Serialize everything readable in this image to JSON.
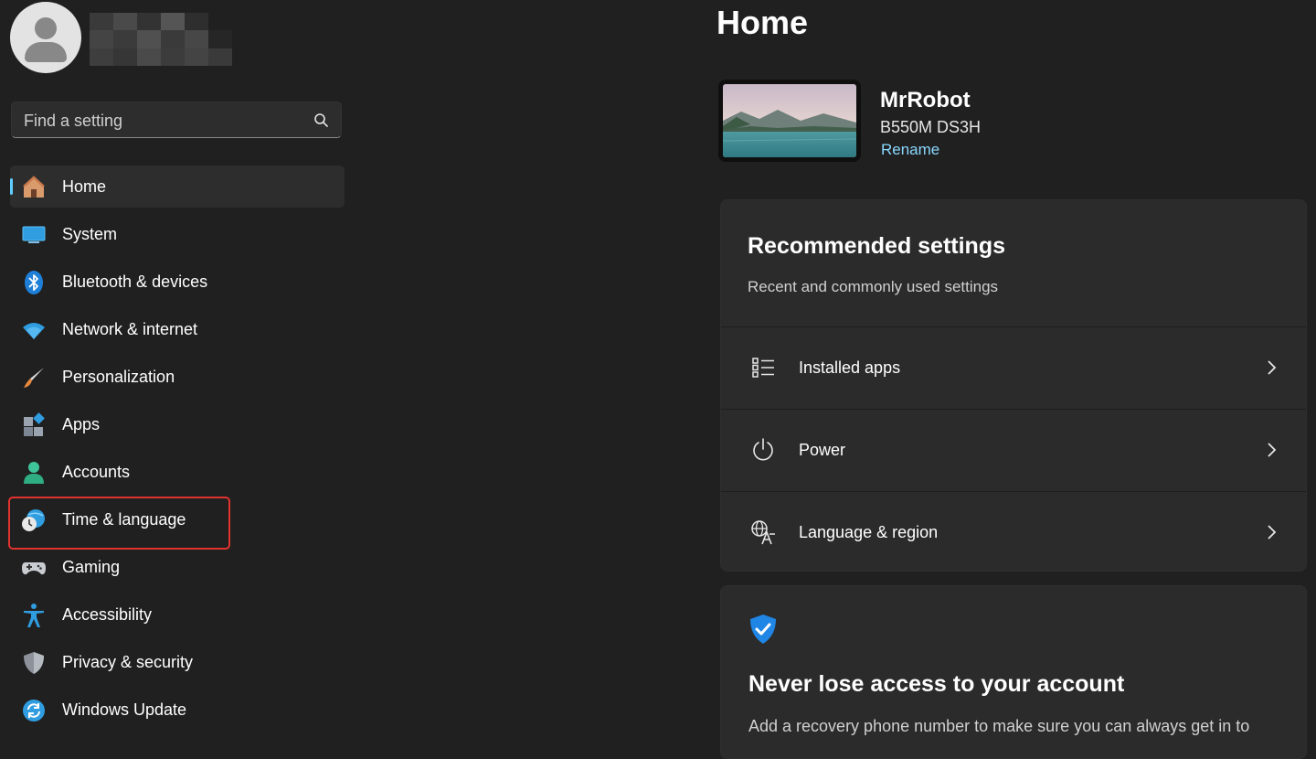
{
  "profile": {
    "avatar_icon": "user-avatar-icon"
  },
  "search": {
    "placeholder": "Find a setting",
    "icon": "search-icon"
  },
  "sidebar": {
    "items": [
      {
        "label": "Home",
        "icon": "home-icon",
        "active": true
      },
      {
        "label": "System",
        "icon": "monitor-icon"
      },
      {
        "label": "Bluetooth & devices",
        "icon": "bluetooth-icon"
      },
      {
        "label": "Network & internet",
        "icon": "wifi-icon"
      },
      {
        "label": "Personalization",
        "icon": "brush-icon"
      },
      {
        "label": "Apps",
        "icon": "apps-icon"
      },
      {
        "label": "Accounts",
        "icon": "person-icon"
      },
      {
        "label": "Time & language",
        "icon": "globe-clock-icon",
        "highlighted": true
      },
      {
        "label": "Gaming",
        "icon": "gamepad-icon"
      },
      {
        "label": "Accessibility",
        "icon": "accessibility-icon"
      },
      {
        "label": "Privacy & security",
        "icon": "shield-icon"
      },
      {
        "label": "Windows Update",
        "icon": "sync-icon"
      }
    ]
  },
  "main": {
    "title": "Home",
    "device": {
      "name": "MrRobot",
      "model": "B550M DS3H",
      "rename_label": "Rename"
    },
    "recommended": {
      "title": "Recommended settings",
      "subtitle": "Recent and commonly used settings",
      "rows": [
        {
          "label": "Installed apps",
          "icon": "installed-apps-icon"
        },
        {
          "label": "Power",
          "icon": "power-icon"
        },
        {
          "label": "Language & region",
          "icon": "language-icon"
        }
      ]
    },
    "account_card": {
      "title": "Never lose access to your account",
      "description": "Add a recovery phone number to make sure you can always get in to"
    }
  },
  "colors": {
    "accent": "#60cdff",
    "highlight": "#e0322f",
    "background": "#202020",
    "card": "#2b2b2b"
  }
}
